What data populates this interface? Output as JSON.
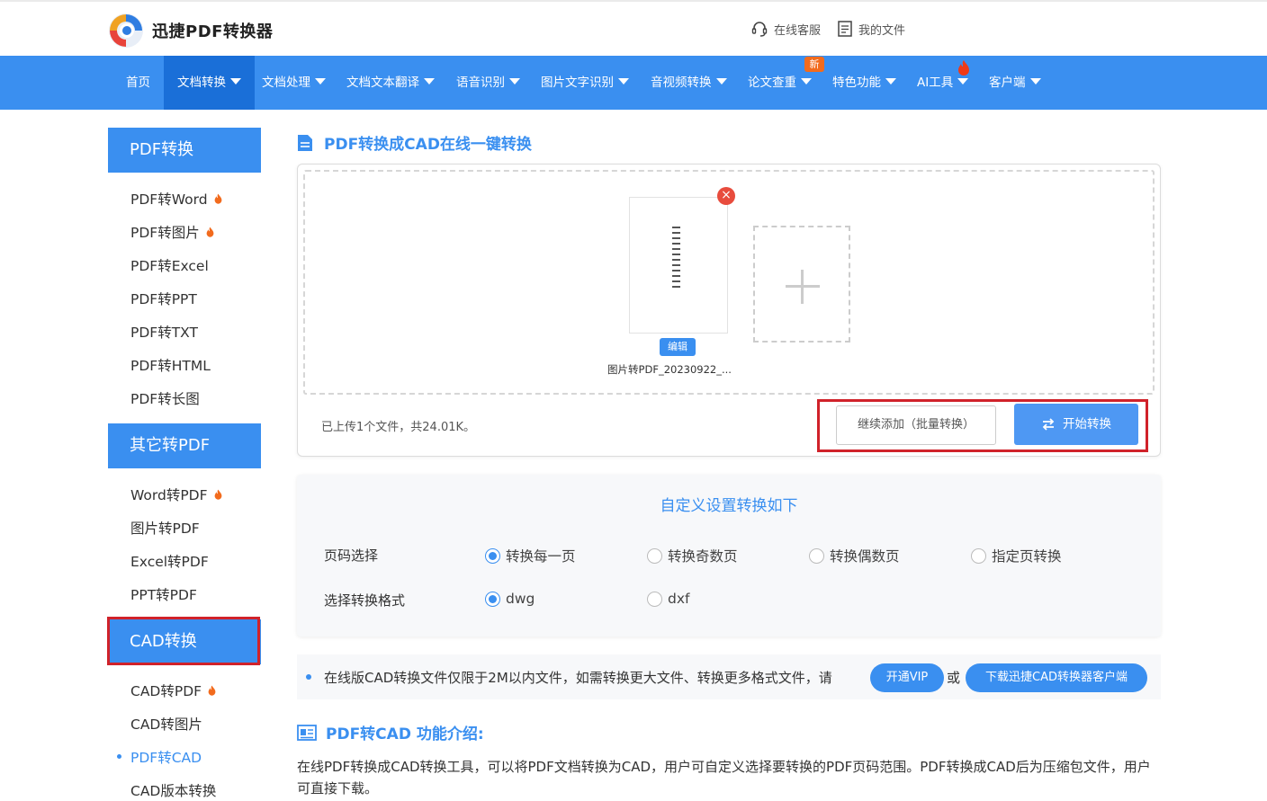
{
  "brand": {
    "name": "迅捷PDF转换器"
  },
  "top_links": {
    "service": "在线客服",
    "my_files": "我的文件"
  },
  "nav": {
    "home": "首页",
    "doc_convert": "文档转换",
    "doc_process": "文档处理",
    "doc_translate": "文档文本翻译",
    "speech": "语音识别",
    "ocr": "图片文字识别",
    "av_convert": "音视频转换",
    "paper_check": "论文查重",
    "new_badge": "新",
    "features": "特色功能",
    "ai_tools": "AI工具",
    "client": "客户端"
  },
  "sidebar": {
    "pdf_convert": {
      "title": "PDF转换",
      "items": [
        "PDF转Word",
        "PDF转图片",
        "PDF转Excel",
        "PDF转PPT",
        "PDF转TXT",
        "PDF转HTML",
        "PDF转长图"
      ]
    },
    "other_to_pdf": {
      "title": "其它转PDF",
      "items": [
        "Word转PDF",
        "图片转PDF",
        "Excel转PDF",
        "PPT转PDF"
      ]
    },
    "cad": {
      "title": "CAD转换",
      "items": [
        "CAD转PDF",
        "CAD转图片",
        "PDF转CAD",
        "CAD版本转换"
      ]
    }
  },
  "main": {
    "page_title": "PDF转换成CAD在线一键转换",
    "file": {
      "edit_label": "编辑",
      "name": "图片转PDF_20230922_..."
    },
    "status": "已上传1个文件，共24.01K。",
    "continue_add": "继续添加（批量转换）",
    "start": "开始转换"
  },
  "settings": {
    "title": "自定义设置转换如下",
    "page_label": "页码选择",
    "page_options": [
      "转换每一页",
      "转换奇数页",
      "转换偶数页",
      "指定页转换"
    ],
    "page_selected": "转换每一页",
    "format_label": "选择转换格式",
    "format_options": [
      "dwg",
      "dxf"
    ],
    "format_selected": "dwg"
  },
  "notice": {
    "text": "在线版CAD转换文件仅限于2M以内文件，如需转换更大文件、转换更多格式文件，请",
    "vip_button": "开通VIP",
    "or": "或",
    "download_button": "下载迅捷CAD转换器客户端"
  },
  "intro": {
    "title": "PDF转CAD 功能介绍:",
    "text": "在线PDF转换成CAD转换工具，可以将PDF文档转换为CAD，用户可自定义选择要转换的PDF页码范围。PDF转换成CAD后为压缩包文件，用户可直接下载。"
  },
  "colors": {
    "primary": "#3a8ff0",
    "nav_active": "#1a6fd8",
    "highlight_box": "#d0222a",
    "hot": "#f26b1d"
  },
  "icons": [
    "logo-icon",
    "headset-icon",
    "document-icon",
    "fire-icon",
    "close-icon",
    "plus-icon",
    "swap-icon",
    "info-doc-icon"
  ]
}
